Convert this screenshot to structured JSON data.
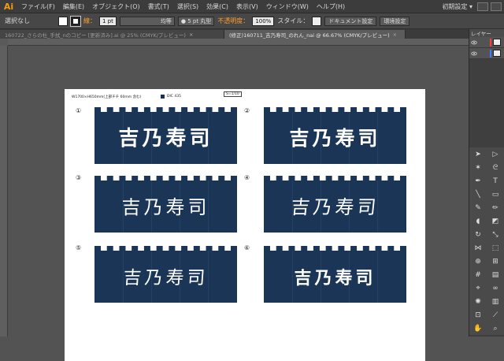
{
  "app": {
    "logo": "Ai"
  },
  "menu": {
    "items": [
      "ファイル(F)",
      "編集(E)",
      "オブジェクト(O)",
      "書式(T)",
      "選択(S)",
      "効果(C)",
      "表示(V)",
      "ウィンドウ(W)",
      "ヘルプ(H)"
    ],
    "workspace": "初期設定 ▾"
  },
  "control": {
    "selection": "選択なし",
    "stroke_label": "線：",
    "stroke_weight": "1 pt",
    "profile": "均等",
    "brush": "● 5 pt 丸型",
    "opacity_label": "不透明度：",
    "opacity_value": "100%",
    "style_label": "スタイル：",
    "doc_setup": "ドキュメント設定",
    "preferences": "環境設定"
  },
  "tabs": [
    {
      "label": "160722_さらの杜_手拭_nのコピー [更新済み].ai @ 25% (CMYK/プレビュー)",
      "active": false
    },
    {
      "label": "(修正)160711_吉乃寿司_のれん_nai @ 66.67% (CMYK/プレビュー)",
      "active": true
    }
  ],
  "artboard": {
    "spec": "W1700×H650mm(上部チチ 60mm 含む)",
    "dic_label": "DIC 435",
    "scale": "S=1/10",
    "noren": [
      {
        "num": "①",
        "text": "吉乃寿司"
      },
      {
        "num": "②",
        "text": "吉乃寿司"
      },
      {
        "num": "③",
        "text": "吉乃寿司"
      },
      {
        "num": "④",
        "text": "吉乃寿司"
      },
      {
        "num": "⑤",
        "text": "吉乃寿司"
      },
      {
        "num": "⑥",
        "text": "吉乃寿司"
      }
    ]
  },
  "panel": {
    "layers_title": "レイヤー"
  },
  "colors": {
    "noren": "#1b3556",
    "accent": "#ff9d2f"
  }
}
